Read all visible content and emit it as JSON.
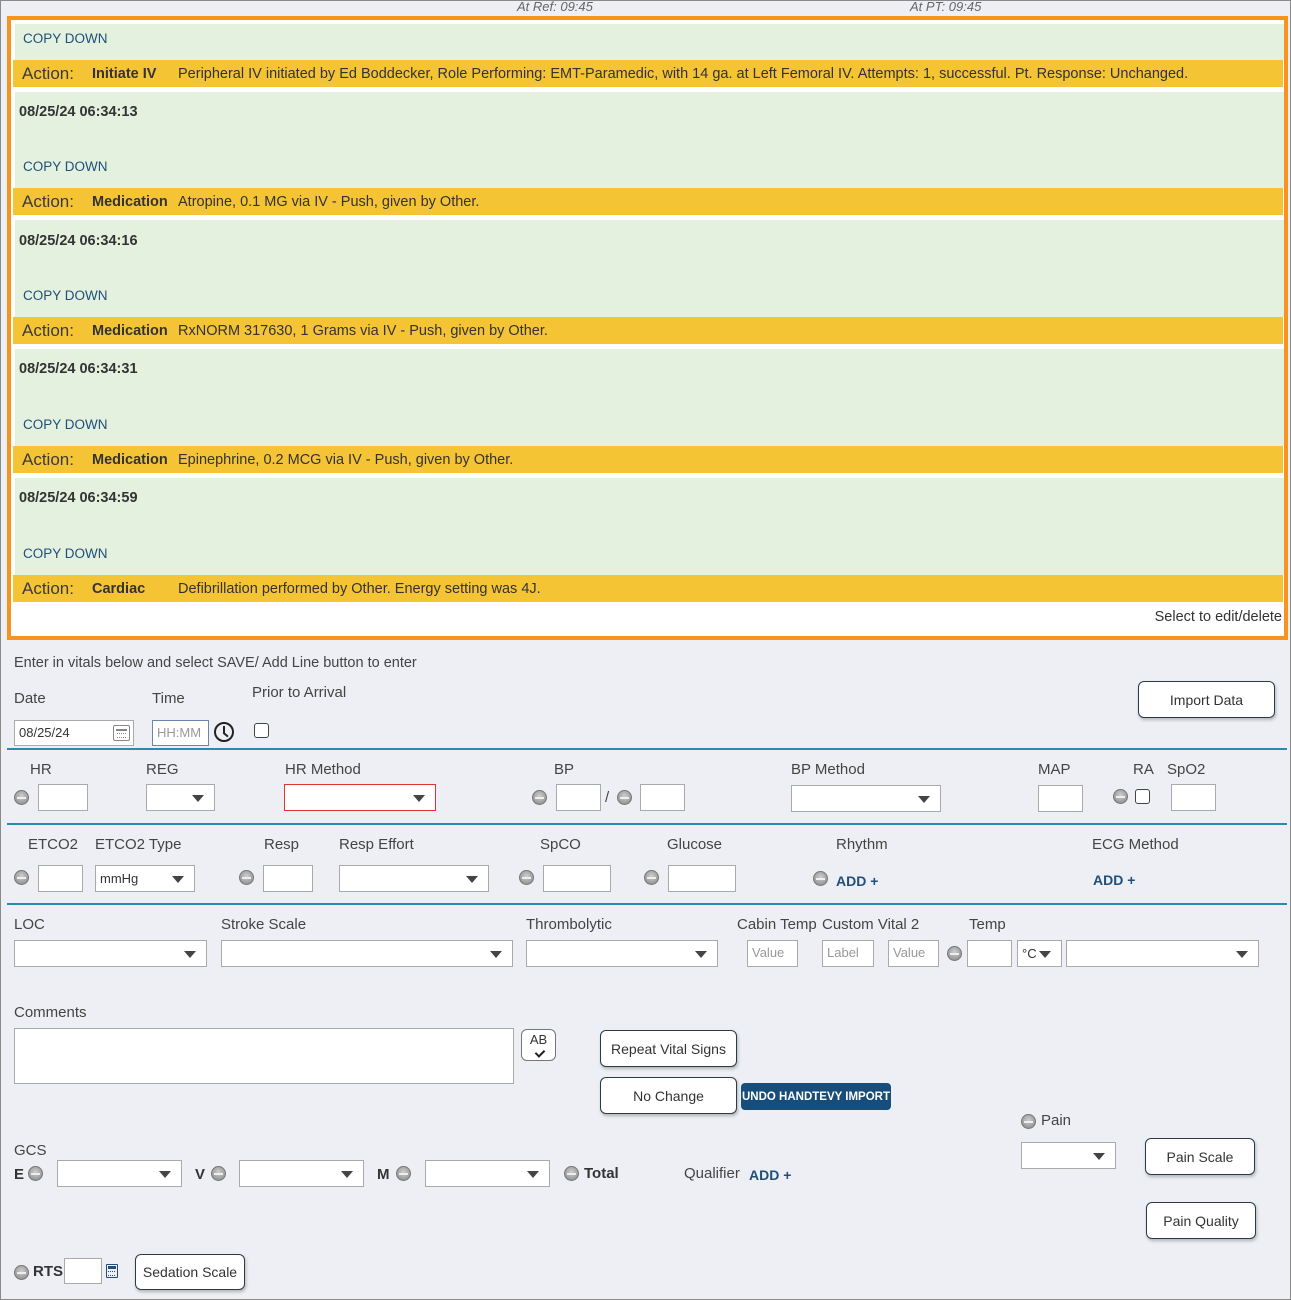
{
  "header": {
    "at_ref": "At Ref: 09:45",
    "at_pt": "At PT: 09:45"
  },
  "log": {
    "copy_down_label": "COPY DOWN",
    "action_prefix": "Action:",
    "entries": [
      {
        "type": "Initiate IV",
        "desc": "Peripheral IV initiated by Ed Boddecker, Role Performing: EMT-Paramedic, with 14 ga. at Left Femoral IV. Attempts: 1, successful. Pt. Response: Unchanged."
      },
      {
        "timestamp": "08/25/24 06:34:13",
        "type": "Medication",
        "desc": "Atropine, 0.1 MG via IV - Push, given by Other."
      },
      {
        "timestamp": "08/25/24 06:34:16",
        "type": "Medication",
        "desc": "RxNORM 317630, 1 Grams via IV - Push, given by Other."
      },
      {
        "timestamp": "08/25/24 06:34:31",
        "type": "Medication",
        "desc": "Epinephrine, 0.2 MCG via IV - Push, given by Other."
      },
      {
        "timestamp": "08/25/24 06:34:59",
        "type": "Cardiac",
        "desc": "Defibrillation performed by Other. Energy setting was 4J."
      }
    ],
    "select_hint": "Select to edit/delete"
  },
  "form": {
    "instructions": "Enter in vitals below and select SAVE/ Add Line button to enter",
    "date_label": "Date",
    "date_value": "08/25/24",
    "time_label": "Time",
    "time_placeholder": "HH:MM",
    "prior_label": "Prior to Arrival",
    "import_button": "Import Data",
    "row1": {
      "hr": "HR",
      "reg": "REG",
      "hr_method": "HR Method",
      "bp": "BP",
      "bp_sep": "/",
      "bp_method": "BP Method",
      "map": "MAP",
      "ra": "RA",
      "spo2": "SpO2"
    },
    "row2": {
      "etco2": "ETCO2",
      "etco2_type": "ETCO2 Type",
      "etco2_type_value": "mmHg",
      "resp": "Resp",
      "resp_effort": "Resp Effort",
      "spco": "SpCO",
      "glucose": "Glucose",
      "rhythm": "Rhythm",
      "ecg_method": "ECG Method",
      "add": "ADD +"
    },
    "row3": {
      "loc": "LOC",
      "stroke": "Stroke Scale",
      "thrombolytic": "Thrombolytic",
      "cabin_temp": "Cabin Temp",
      "custom_vital": "Custom Vital 2",
      "temp": "Temp",
      "value_placeholder": "Value",
      "label_placeholder": "Label",
      "temp_unit": "°C"
    },
    "comments_label": "Comments",
    "spellcheck_label": "AB",
    "repeat_button": "Repeat Vital Signs",
    "no_change_button": "No Change",
    "undo_button": "UNDO HANDTEVY IMPORT",
    "pain_label": "Pain",
    "pain_scale_button": "Pain Scale",
    "pain_quality_button": "Pain Quality",
    "gcs": {
      "label": "GCS",
      "e": "E",
      "v": "V",
      "m": "M",
      "total": "Total",
      "qualifier": "Qualifier",
      "add": "ADD +"
    },
    "rts_label": "RTS",
    "sedation_button": "Sedation Scale"
  }
}
